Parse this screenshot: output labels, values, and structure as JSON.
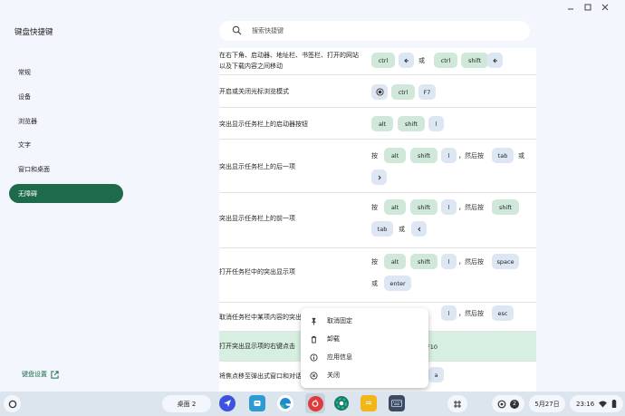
{
  "window": {
    "title": "键盘快捷键",
    "controls": [
      "minimize-icon",
      "maximize-icon",
      "close-icon"
    ]
  },
  "sidebar": {
    "items": [
      {
        "label": "常规",
        "active": false
      },
      {
        "label": "设备",
        "active": false
      },
      {
        "label": "浏览器",
        "active": false
      },
      {
        "label": "文字",
        "active": false
      },
      {
        "label": "窗口和桌面",
        "active": false
      },
      {
        "label": "无障碍",
        "active": true
      }
    ],
    "settings_link": "键盘设置"
  },
  "search": {
    "placeholder": "搜索快捷键"
  },
  "shortcuts": [
    {
      "desc": "在右下角、启动器、地址栏、书签栏、打开的网站以及下载内容之间移动",
      "tokens": {
        "k1": "ctrl",
        "i1": "back-arrow",
        "t1": "或",
        "k2": "ctrl",
        "k3": "shift",
        "i2": "back-arrow"
      }
    },
    {
      "desc": "开启或关闭光标浏览模式",
      "tokens": {
        "i1": "radio-icon",
        "k1": "ctrl",
        "k2": "F7"
      }
    },
    {
      "desc": "突出显示任务栏上的启动器按钮",
      "tokens": {
        "k1": "alt",
        "k2": "shift",
        "k3": "l"
      }
    },
    {
      "desc": "突出显示任务栏上的后一项",
      "tokens": {
        "t1": "按",
        "k1": "alt",
        "k2": "shift",
        "k3": "l",
        "t2": "，然后按",
        "k4": "tab",
        "t3": "或",
        "i1": "forward-arrow"
      }
    },
    {
      "desc": "突出显示任务栏上的前一项",
      "tokens": {
        "t1": "按",
        "k1": "alt",
        "k2": "shift",
        "k3": "l",
        "t2": "，然后按",
        "k4": "shift",
        "k5": "tab",
        "t3": "或",
        "i1": "back-arrow"
      }
    },
    {
      "desc": "打开任务栏中的突出显示项",
      "tokens": {
        "t1": "按",
        "k1": "alt",
        "k2": "shift",
        "k3": "l",
        "t2": "，然后按",
        "k4": "space",
        "t3": "或",
        "k5": "enter"
      }
    },
    {
      "desc": "取消任务栏中某项内容的突出",
      "tokens": {
        "k1": "l",
        "t1": "，然后按",
        "k2": "esc"
      }
    },
    {
      "desc": "打开突出显示项的右键点击",
      "tokens": {
        "k1": "F10"
      }
    },
    {
      "desc": "将焦点移至弹出式窗口和对话",
      "tokens": {
        "k1": "a"
      }
    }
  ],
  "context_menu": {
    "items": [
      {
        "icon": "pin-icon",
        "label": "取消固定"
      },
      {
        "icon": "trash-icon",
        "label": "卸载"
      },
      {
        "icon": "info-icon",
        "label": "应用信息"
      },
      {
        "icon": "close-circle-icon",
        "label": "关闭"
      }
    ]
  },
  "shelf": {
    "desk": "桌面 2",
    "apps": [
      "send-app-icon",
      "files-app-icon",
      "edge-app-icon",
      "netease-music-app-icon",
      "chrome-app-icon",
      "notes-app-icon",
      "keyboard-app-icon"
    ],
    "status": {
      "notification_count": "2",
      "date": "5月27日",
      "time": "23:16"
    }
  },
  "colors": {
    "accent": "#1d6b4a",
    "mod_key": "#cfe8d9",
    "key": "#dde6f3",
    "highlight_row": "#d7efe0"
  }
}
